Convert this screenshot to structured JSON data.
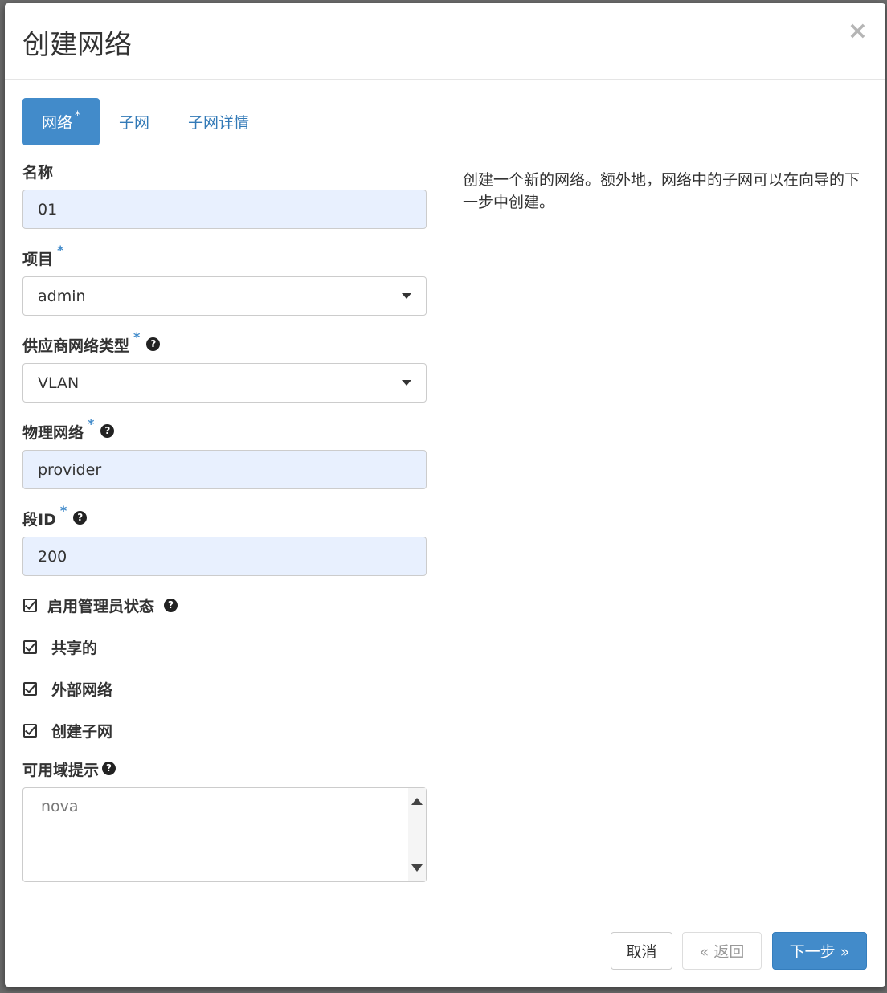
{
  "modal": {
    "title": "创建网络",
    "close": "×"
  },
  "tabs": [
    {
      "label": "网络",
      "required": "*",
      "active": true
    },
    {
      "label": "子网"
    },
    {
      "label": "子网详情"
    }
  ],
  "form": {
    "name": {
      "label": "名称",
      "value": "01"
    },
    "project": {
      "label": "项目",
      "required": "*",
      "value": "admin"
    },
    "provider_type": {
      "label": "供应商网络类型",
      "required": "*",
      "value": "VLAN"
    },
    "physical_network": {
      "label": "物理网络",
      "required": "*",
      "value": "provider"
    },
    "segment_id": {
      "label": "段ID",
      "required": "*",
      "value": "200"
    },
    "checkboxes": [
      {
        "label": "启用管理员状态",
        "checked": true,
        "help": true
      },
      {
        "label": "共享的",
        "checked": true
      },
      {
        "label": "外部网络",
        "checked": true
      },
      {
        "label": "创建子网",
        "checked": true
      }
    ],
    "az_hints": {
      "label": "可用域提示",
      "options": [
        "nova"
      ]
    }
  },
  "description": "创建一个新的网络。额外地，网络中的子网可以在向导的下一步中创建。",
  "footer": {
    "cancel": "取消",
    "back": "« 返回",
    "next": "下一步 »"
  },
  "colors": {
    "primary": "#428bca",
    "required": "#428bca"
  }
}
